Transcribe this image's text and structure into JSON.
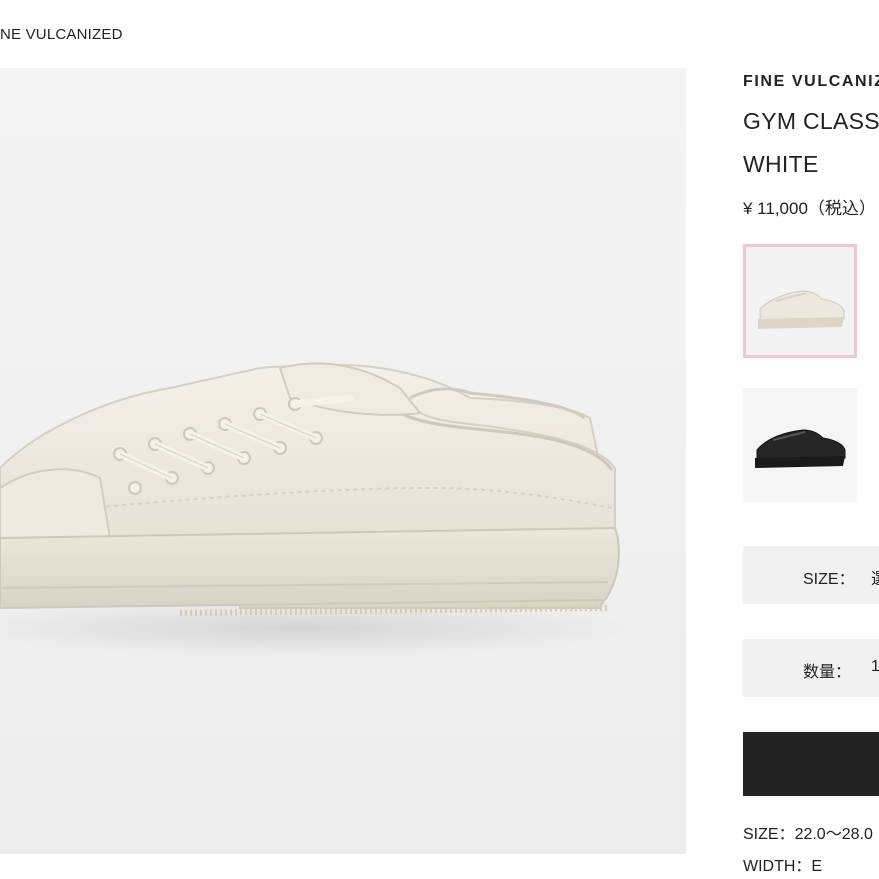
{
  "breadcrumb": {
    "current": "NE VULCANIZED"
  },
  "product": {
    "brand": "FINE VULCANIZ",
    "name": "GYM CLASSIC",
    "color": "WHITE",
    "price": "¥ 11,000（税込）"
  },
  "thumbnails": [
    {
      "color_name": "white",
      "selected": true,
      "swatch": "#eae6dc"
    },
    {
      "color_name": "black",
      "selected": false,
      "swatch": "#1c1c1c"
    }
  ],
  "options": {
    "size_label": "SIZE：",
    "size_value": "選",
    "quantity_label": "数量：",
    "quantity_value": "1"
  },
  "cart_button": {
    "label": ""
  },
  "specs": {
    "size_range": "SIZE：22.0〜28.0",
    "width": "WIDTH：E"
  },
  "colors": {
    "selected_border": "#f0c6cf",
    "option_bg": "#f1f1f1",
    "cart_bg": "#222222",
    "canvas_white": "#ece8de"
  }
}
